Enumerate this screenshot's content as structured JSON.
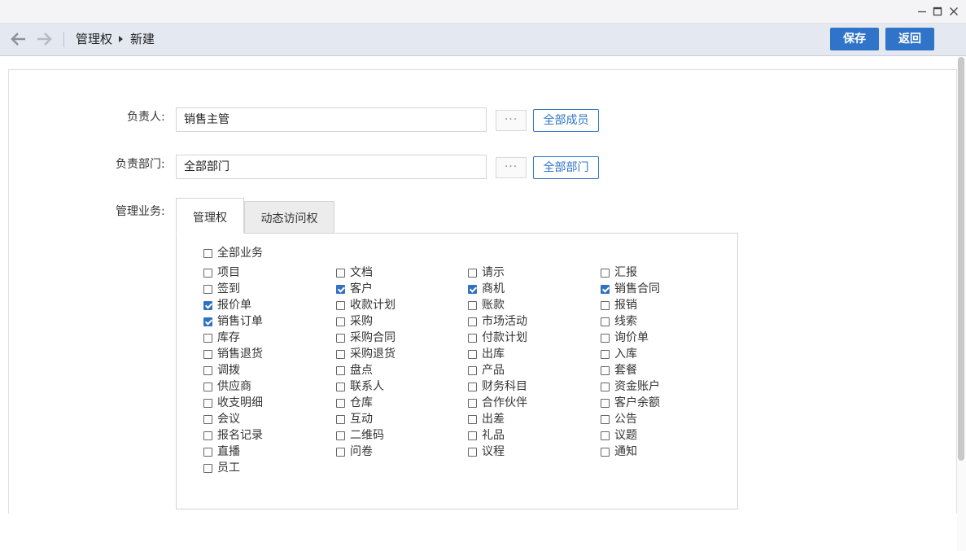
{
  "window": {
    "minimize_glyph": "—",
    "maximize_glyph": "□",
    "close_glyph": "✕"
  },
  "breadcrumb": {
    "root": "管理权",
    "current": "新建"
  },
  "toolbar": {
    "save_label": "保存",
    "back_label": "返回"
  },
  "form": {
    "owner": {
      "label": "负责人:",
      "value": "销售主管",
      "dots": "···",
      "button": "全部成员"
    },
    "department": {
      "label": "负责部门:",
      "value": "全部部门",
      "dots": "···",
      "button": "全部部门"
    },
    "business": {
      "label": "管理业务:"
    }
  },
  "tabs": [
    {
      "label": "管理权",
      "active": true
    },
    {
      "label": "动态访问权",
      "active": false
    }
  ],
  "all_business": {
    "label": "全部业务",
    "checked": false
  },
  "business_items": [
    {
      "label": "项目",
      "checked": false
    },
    {
      "label": "文档",
      "checked": false
    },
    {
      "label": "请示",
      "checked": false
    },
    {
      "label": "汇报",
      "checked": false
    },
    {
      "label": "签到",
      "checked": false
    },
    {
      "label": "客户",
      "checked": true
    },
    {
      "label": "商机",
      "checked": true
    },
    {
      "label": "销售合同",
      "checked": true
    },
    {
      "label": "报价单",
      "checked": true
    },
    {
      "label": "收款计划",
      "checked": false
    },
    {
      "label": "账款",
      "checked": false
    },
    {
      "label": "报销",
      "checked": false
    },
    {
      "label": "销售订单",
      "checked": true
    },
    {
      "label": "采购",
      "checked": false
    },
    {
      "label": "市场活动",
      "checked": false
    },
    {
      "label": "线索",
      "checked": false
    },
    {
      "label": "库存",
      "checked": false
    },
    {
      "label": "采购合同",
      "checked": false
    },
    {
      "label": "付款计划",
      "checked": false
    },
    {
      "label": "询价单",
      "checked": false
    },
    {
      "label": "销售退货",
      "checked": false
    },
    {
      "label": "采购退货",
      "checked": false
    },
    {
      "label": "出库",
      "checked": false
    },
    {
      "label": "入库",
      "checked": false
    },
    {
      "label": "调拨",
      "checked": false
    },
    {
      "label": "盘点",
      "checked": false
    },
    {
      "label": "产品",
      "checked": false
    },
    {
      "label": "套餐",
      "checked": false
    },
    {
      "label": "供应商",
      "checked": false
    },
    {
      "label": "联系人",
      "checked": false
    },
    {
      "label": "财务科目",
      "checked": false
    },
    {
      "label": "资金账户",
      "checked": false
    },
    {
      "label": "收支明细",
      "checked": false
    },
    {
      "label": "仓库",
      "checked": false
    },
    {
      "label": "合作伙伴",
      "checked": false
    },
    {
      "label": "客户余额",
      "checked": false
    },
    {
      "label": "会议",
      "checked": false
    },
    {
      "label": "互动",
      "checked": false
    },
    {
      "label": "出差",
      "checked": false
    },
    {
      "label": "公告",
      "checked": false
    },
    {
      "label": "报名记录",
      "checked": false
    },
    {
      "label": "二维码",
      "checked": false
    },
    {
      "label": "礼品",
      "checked": false
    },
    {
      "label": "议题",
      "checked": false
    },
    {
      "label": "直播",
      "checked": false
    },
    {
      "label": "问卷",
      "checked": false
    },
    {
      "label": "议程",
      "checked": false
    },
    {
      "label": "通知",
      "checked": false
    },
    {
      "label": "员工",
      "checked": false
    }
  ],
  "colors": {
    "accent": "#2f74c8",
    "checked": "#3071c4",
    "navbar": "#e4e8f1"
  }
}
